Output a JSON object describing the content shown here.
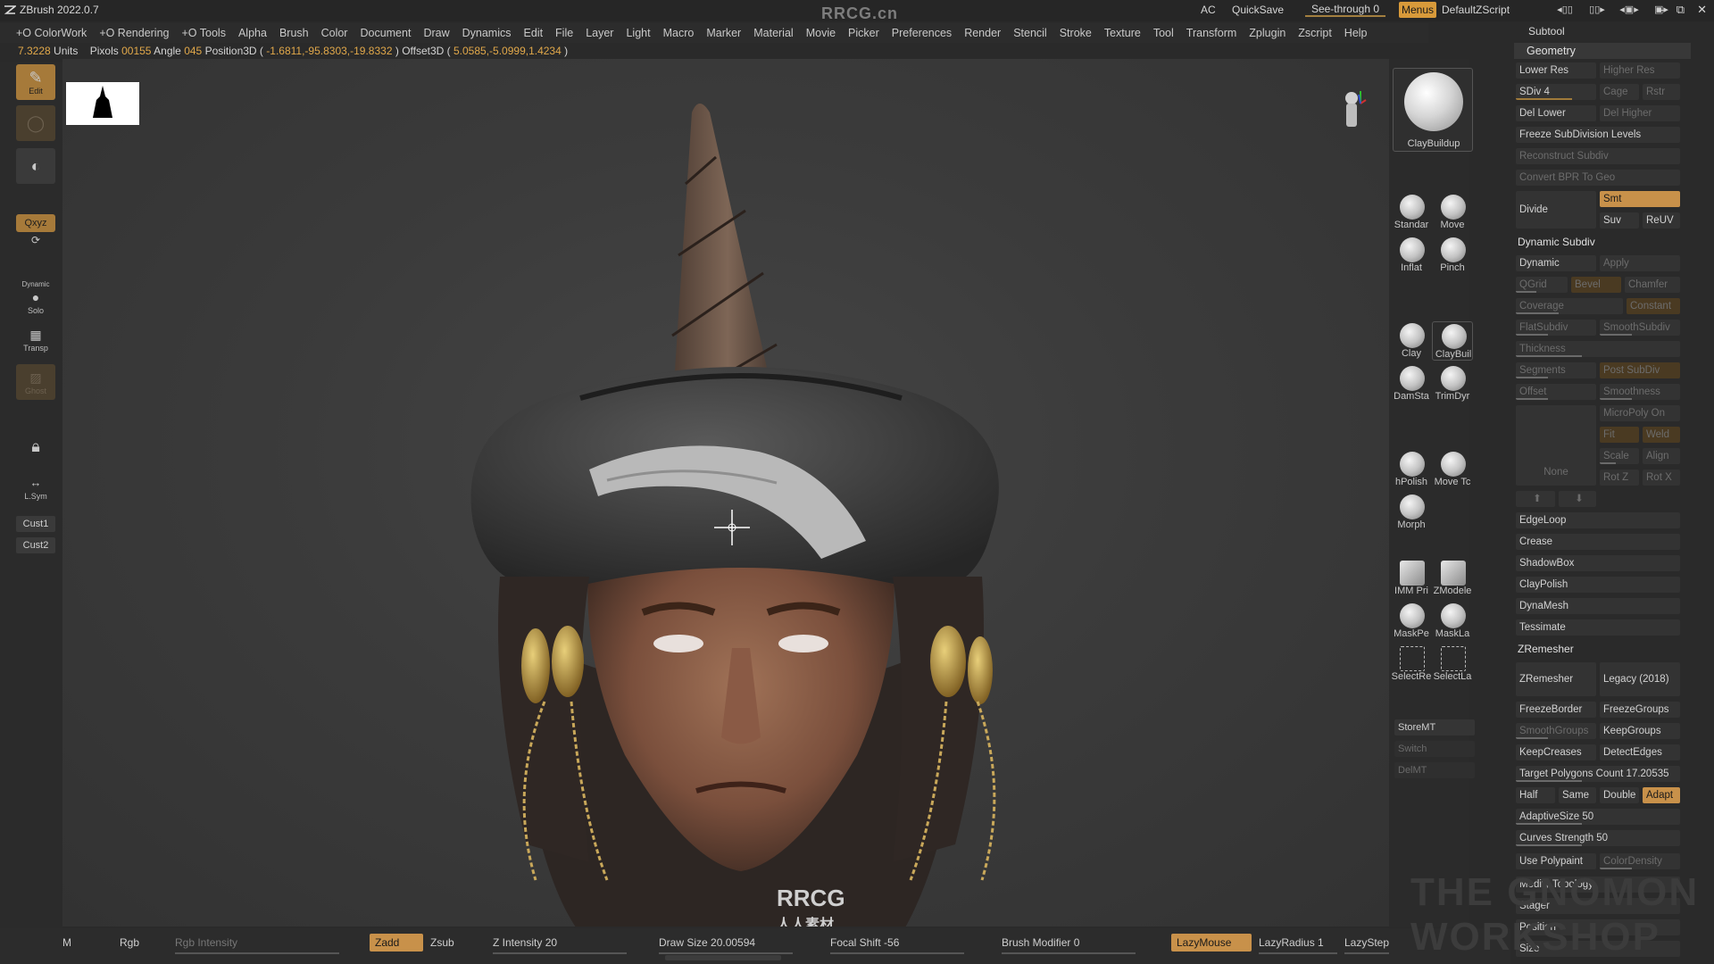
{
  "titlebar": {
    "app_title": "ZBrush 2022.0.7",
    "watermark": "RRCG.cn",
    "ac": "AC",
    "quicksave": "QuickSave",
    "see_through": "See-through",
    "see_through_value": "0",
    "menus": "Menus",
    "script": "DefaultZScript"
  },
  "menubar": [
    "+O ColorWork",
    "+O Rendering",
    "+O Tools",
    "Alpha",
    "Brush",
    "Color",
    "Document",
    "Draw",
    "Dynamics",
    "Edit",
    "File",
    "Layer",
    "Light",
    "Macro",
    "Marker",
    "Material",
    "Movie",
    "Picker",
    "Preferences",
    "Render",
    "Stencil",
    "Stroke",
    "Texture",
    "Tool",
    "Transform",
    "Zplugin",
    "Zscript",
    "Help"
  ],
  "infobar": {
    "units_value": "7.3228",
    "units_label": "Units",
    "pixols_label": "Pixols",
    "pixols_value": "00155",
    "angle_label": "Angle",
    "angle_value": "045",
    "pos_label": "Position3D (",
    "pos_value": "-1.6811,-95.8303,-19.8332",
    "offset_label": ") Offset3D (",
    "offset_value": "5.0585,-5.0999,1.4234",
    "close": ")"
  },
  "leftshelf": {
    "edit": "Edit",
    "xyz": "Qxyz",
    "dynamic": "Dynamic",
    "solo": "Solo",
    "transp": "Transp",
    "ghost": "Ghost",
    "lsym": "L.Sym",
    "cust1": "Cust1",
    "cust2": "Cust2"
  },
  "brushes": {
    "current": "ClayBuildup",
    "items": [
      "Standar",
      "Move",
      "Inflat",
      "Pinch",
      "Clay",
      "ClayBuil",
      "DamSta",
      "TrimDyr",
      "hPolish",
      "Move Tc",
      "Morph",
      "IMM Pri",
      "ZModele",
      "MaskPe",
      "MaskLa",
      "SelectRe",
      "SelectLa"
    ],
    "storemt": "StoreMT",
    "switch": "Switch",
    "delmt": "DelMT"
  },
  "rightpanel": {
    "subtool": "Subtool",
    "geometry": "Geometry",
    "lower_res": "Lower Res",
    "higher_res": "Higher Res",
    "sdiv": "SDiv 4",
    "cage": "Cage",
    "rstr": "Rstr",
    "del_lower": "Del Lower",
    "del_higher": "Del Higher",
    "freeze_sub": "Freeze SubDivision Levels",
    "reconstruct": "Reconstruct Subdiv",
    "convert_bpr": "Convert BPR To Geo",
    "divide": "Divide",
    "smt": "Smt",
    "suv": "Suv",
    "reuv": "ReUV",
    "dynamic_subdiv": "Dynamic Subdiv",
    "dynamic": "Dynamic",
    "apply": "Apply",
    "qgrid": "QGrid",
    "bevel": "Bevel",
    "chamfer": "Chamfer",
    "coverage": "Coverage",
    "constant": "Constant",
    "flatsubdiv": "FlatSubdiv",
    "smoothsubdiv": "SmoothSubdiv",
    "thickness": "Thickness",
    "segments": "Segments",
    "post_subdiv": "Post SubDiv",
    "offset": "Offset",
    "smoothness": "Smoothness",
    "micropoly": "MicroPoly On",
    "fit": "Fit",
    "weld": "Weld",
    "scale": "Scale",
    "align": "Align",
    "none": "None",
    "rotz": "Rot Z",
    "rotx": "Rot X",
    "edgeloop": "EdgeLoop",
    "crease": "Crease",
    "shadowbox": "ShadowBox",
    "claypolish": "ClayPolish",
    "dynamesh": "DynaMesh",
    "tessimate": "Tessimate",
    "zremesher_sec": "ZRemesher",
    "zremesher": "ZRemesher",
    "legacy": "Legacy (2018)",
    "freezeborder": "FreezeBorder",
    "freezegroups": "FreezeGroups",
    "smoothgroups": "SmoothGroups",
    "keepgroups": "KeepGroups",
    "keepcreases": "KeepCreases",
    "detectedges": "DetectEdges",
    "target_polys": "Target Polygons Count 17.20535",
    "half": "Half",
    "same": "Same",
    "double": "Double",
    "adapt": "Adapt",
    "adaptivesize": "AdaptiveSize 50",
    "curves": "Curves Strength 50",
    "usepolypaint": "Use Polypaint",
    "colordensity": "ColorDensity",
    "modify_topo": "Modify Topology",
    "stager": "Stager",
    "position": "Position",
    "size": "Size"
  },
  "bottombar": {
    "m": "M",
    "rgb": "Rgb",
    "rgb_intensity": "Rgb Intensity",
    "zadd": "Zadd",
    "zsub": "Zsub",
    "z_intensity": "Z Intensity 20",
    "draw_size": "Draw Size 20.00594",
    "focal_shift": "Focal Shift -56",
    "brush_modifier": "Brush Modifier 0",
    "lazymouse": "LazyMouse",
    "lazyradius": "LazyRadius 1",
    "lazystep": "LazyStep"
  },
  "watermarks": {
    "canvas": "RRCG",
    "canvas_sub": "人人素材",
    "corner": "THE GNOMON WORKSHOP"
  },
  "colors": {
    "accent": "#c8914a",
    "panel": "#2a2a2a",
    "canvas": "#3b3b3b"
  }
}
